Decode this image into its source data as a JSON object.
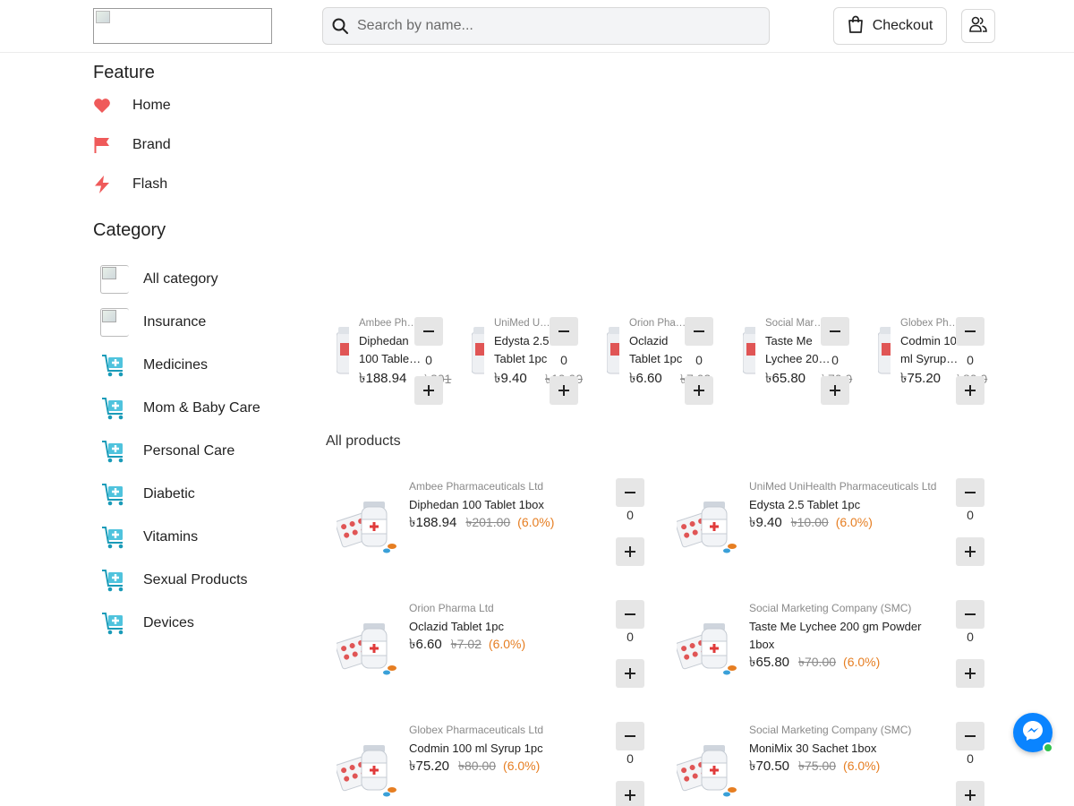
{
  "header": {
    "search_placeholder": "Search by name...",
    "checkout_label": "Checkout"
  },
  "sidebar": {
    "feature_heading": "Feature",
    "features": [
      {
        "label": "Home",
        "icon": "heart-icon",
        "color": "#ef5a5a"
      },
      {
        "label": "Brand",
        "icon": "flag-icon",
        "color": "#ef5a5a"
      },
      {
        "label": "Flash",
        "icon": "lightning-icon",
        "color": "#ef5a5a"
      }
    ],
    "category_heading": "Category",
    "categories": [
      {
        "label": "All category",
        "icon": "broken-image-icon"
      },
      {
        "label": "Insurance",
        "icon": "broken-image-icon"
      },
      {
        "label": "Medicines",
        "icon": "medical-cart-icon"
      },
      {
        "label": "Mom & Baby Care",
        "icon": "medical-cart-icon"
      },
      {
        "label": "Personal Care",
        "icon": "medical-cart-icon"
      },
      {
        "label": "Diabetic",
        "icon": "medical-cart-icon"
      },
      {
        "label": "Vitamins",
        "icon": "medical-cart-icon"
      },
      {
        "label": "Sexual Products",
        "icon": "medical-cart-icon"
      },
      {
        "label": "Devices",
        "icon": "medical-cart-icon"
      }
    ]
  },
  "flash_products": [
    {
      "brand": "Ambee Pha…",
      "name": "Diphedan 100 Table…",
      "price": "৳188.94",
      "old_price": "৳201",
      "qty": "0"
    },
    {
      "brand": "UniMed Uni…",
      "name": "Edysta 2.5 Tablet 1pc",
      "price": "৳9.40",
      "old_price": "৳10.00",
      "qty": "0"
    },
    {
      "brand": "Orion Phar…",
      "name": "Oclazid Tablet 1pc",
      "price": "৳6.60",
      "old_price": "৳7.02",
      "qty": "0"
    },
    {
      "brand": "Social Mark…",
      "name": "Taste Me Lychee 20…",
      "price": "৳65.80",
      "old_price": "৳70.0",
      "qty": "0"
    },
    {
      "brand": "Globex Pha…",
      "name": "Codmin 100 ml Syrup 1pc",
      "price": "৳75.20",
      "old_price": "৳80.0",
      "qty": "0"
    }
  ],
  "all_products_heading": "All products",
  "products": [
    {
      "brand": "Ambee Pharmaceuticals Ltd",
      "name": "Diphedan 100 Tablet 1box",
      "price": "৳188.94",
      "old_price": "৳201.00",
      "discount": "(6.0%)",
      "qty": "0"
    },
    {
      "brand": "UniMed UniHealth Pharmaceuticals Ltd",
      "name": "Edysta 2.5 Tablet 1pc",
      "price": "৳9.40",
      "old_price": "৳10.00",
      "discount": "(6.0%)",
      "qty": "0"
    },
    {
      "brand": "Orion Pharma Ltd",
      "name": "Oclazid Tablet 1pc",
      "price": "৳6.60",
      "old_price": "৳7.02",
      "discount": "(6.0%)",
      "qty": "0"
    },
    {
      "brand": "Social Marketing Company (SMC)",
      "name": "Taste Me Lychee 200 gm Powder 1box",
      "price": "৳65.80",
      "old_price": "৳70.00",
      "discount": "(6.0%)",
      "qty": "0"
    },
    {
      "brand": "Globex Pharmaceuticals Ltd",
      "name": "Codmin 100 ml Syrup 1pc",
      "price": "৳75.20",
      "old_price": "৳80.00",
      "discount": "(6.0%)",
      "qty": "0"
    },
    {
      "brand": "Social Marketing Company (SMC)",
      "name": "MoniMix 30 Sachet 1box",
      "price": "৳70.50",
      "old_price": "৳75.00",
      "discount": "(6.0%)",
      "qty": "0"
    }
  ],
  "colors": {
    "accent_red": "#ef5a5a",
    "discount_orange": "#e67e22",
    "category_icon_teal": "#1aa7c2",
    "messenger_blue": "#0a84ff",
    "online_green": "#31c24d"
  }
}
